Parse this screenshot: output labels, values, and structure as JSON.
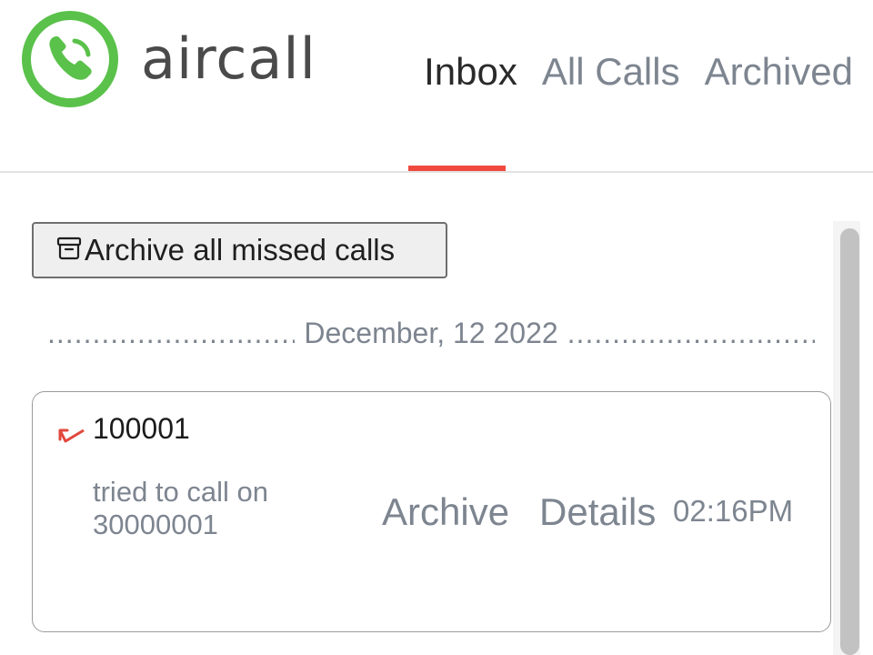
{
  "brand": {
    "name": "aircall",
    "accent_color": "#5ac14a",
    "logo_icon": "phone-icon"
  },
  "tabs": [
    {
      "label": "Inbox",
      "active": true
    },
    {
      "label": "All Calls",
      "active": false
    },
    {
      "label": "Archived",
      "active": false
    }
  ],
  "tab_indicator_color": "#f0493e",
  "toolbar": {
    "archive_all_label": "Archive all missed calls",
    "archive_icon": "archive-box-icon"
  },
  "date_group": {
    "label": "December, 12 2022",
    "dots": "................................................................................"
  },
  "calls": [
    {
      "caller": "100001",
      "status_icon": "missed-call-icon",
      "status_color": "#e2483d",
      "description": "tried to call on 30000001",
      "archive_label": "Archive",
      "details_label": "Details",
      "time": "02:16PM"
    }
  ]
}
